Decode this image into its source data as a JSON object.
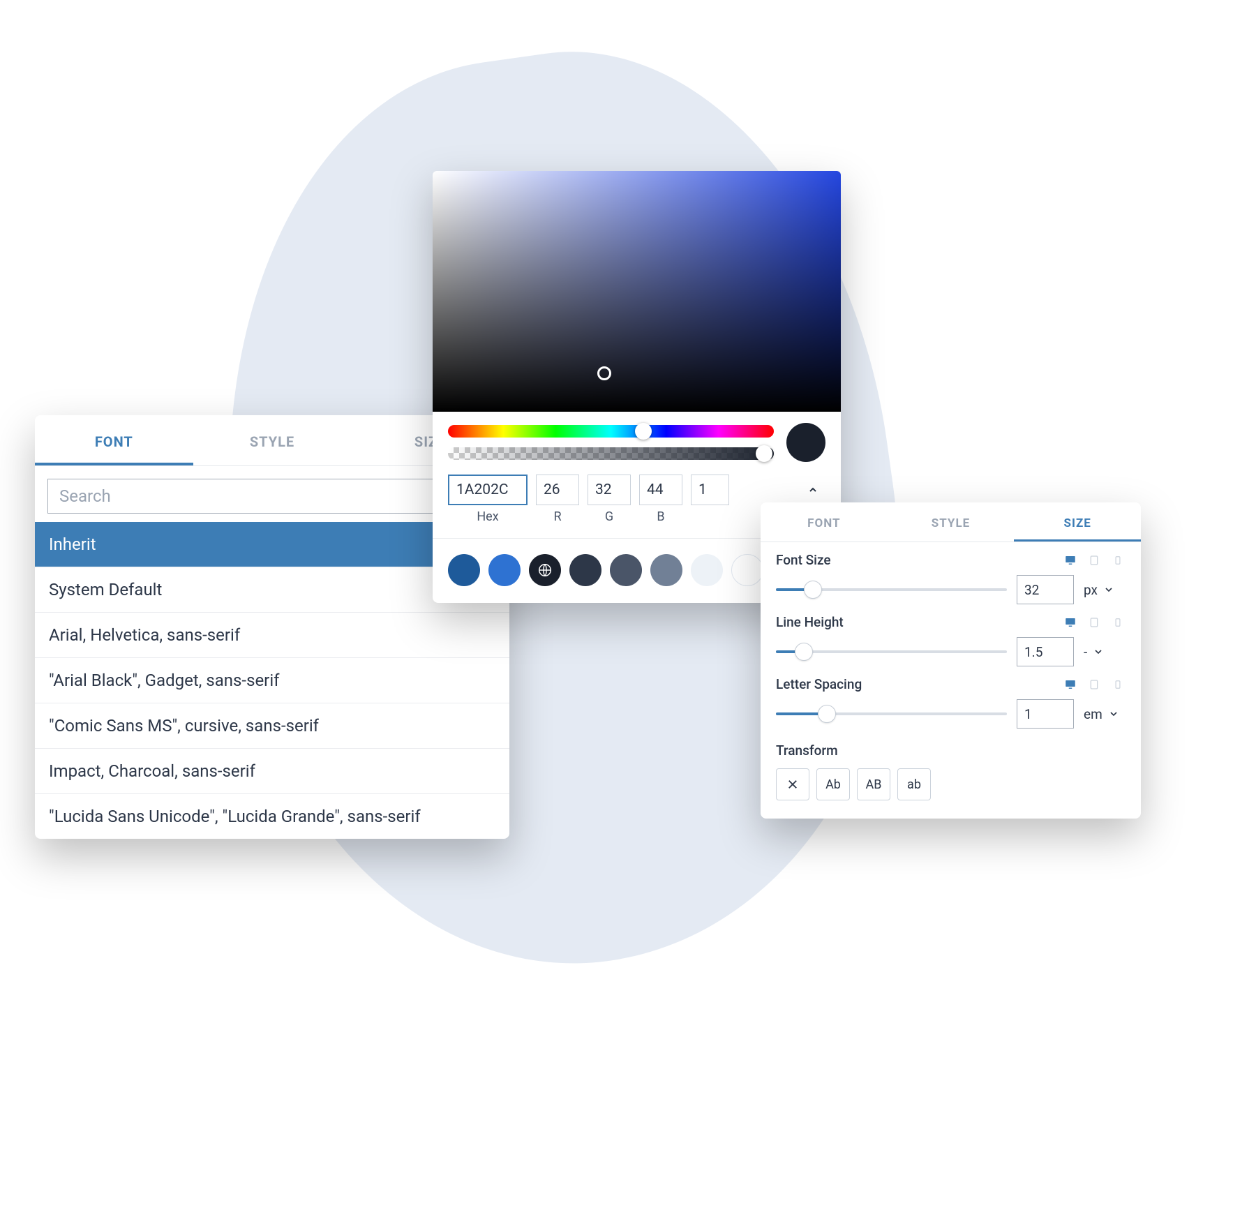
{
  "font_panel": {
    "tabs": [
      "FONT",
      "STYLE",
      "SIZE"
    ],
    "active_tab": 0,
    "search_placeholder": "Search",
    "items": [
      "Inherit",
      "System Default",
      "Arial, Helvetica, sans-serif",
      "\"Arial Black\", Gadget, sans-serif",
      "\"Comic Sans MS\", cursive, sans-serif",
      "Impact, Charcoal, sans-serif",
      "\"Lucida Sans Unicode\", \"Lucida Grande\", sans-serif"
    ],
    "selected_index": 0
  },
  "color_picker": {
    "hex": "1A202C",
    "r": "26",
    "g": "32",
    "b": "44",
    "a": "1",
    "labels": {
      "hex": "Hex",
      "r": "R",
      "g": "G",
      "b": "B"
    },
    "current_color": "#1A202C",
    "hue_handle_pct": 60,
    "alpha_handle_pct": 97,
    "swatches": [
      {
        "color": "#1E5A9A",
        "icon": null
      },
      {
        "color": "#2E72D2",
        "icon": null
      },
      {
        "color": "#1A202C",
        "icon": "globe"
      },
      {
        "color": "#2D3748",
        "icon": null
      },
      {
        "color": "#4A5568",
        "icon": null
      },
      {
        "color": "#718096",
        "icon": null
      },
      {
        "color": "#EDF2F7",
        "icon": null
      },
      {
        "color": "#FFFFFF",
        "icon": null
      }
    ]
  },
  "size_panel": {
    "tabs": [
      "FONT",
      "STYLE",
      "SIZE"
    ],
    "active_tab": 2,
    "props": [
      {
        "label": "Font Size",
        "value": "32",
        "unit": "px",
        "fill_pct": 16
      },
      {
        "label": "Line Height",
        "value": "1.5",
        "unit": "-",
        "fill_pct": 12
      },
      {
        "label": "Letter Spacing",
        "value": "1",
        "unit": "em",
        "fill_pct": 22
      }
    ],
    "transform": {
      "label": "Transform",
      "options": [
        "×",
        "Ab",
        "AB",
        "ab"
      ]
    }
  }
}
